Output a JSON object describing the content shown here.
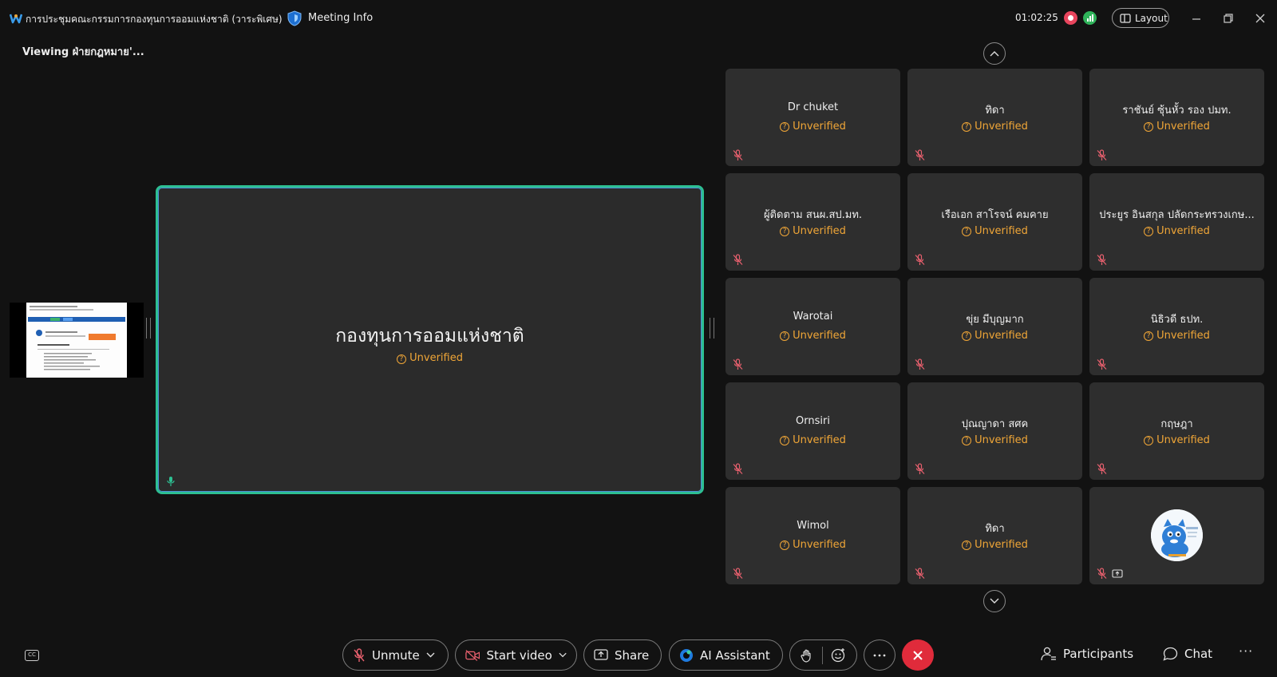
{
  "titlebar": {
    "meeting_title": "การประชุมคณะกรรมการกองทุนการออมแห่งชาติ (วาระพิเศษ)",
    "meeting_info_label": "Meeting Info",
    "timer": "01:02:25",
    "layout_label": "Layout"
  },
  "viewing_text": "Viewing ฝ่ายกฎหมาย'...",
  "main_stage": {
    "name": "กองทุนการออมแห่งชาติ",
    "status": "Unverified"
  },
  "participants": [
    {
      "name": "Dr chuket",
      "status": "Unverified"
    },
    {
      "name": "ทิดา",
      "status": "Unverified"
    },
    {
      "name": "ราชันย์ ซุ้นหั้ว รอง ปมท.",
      "status": "Unverified"
    },
    {
      "name": "ผู้ติดตาม สนผ.สป.มท.",
      "status": "Unverified"
    },
    {
      "name": "เรือเอก สาโรจน์ คมคาย",
      "status": "Unverified"
    },
    {
      "name": "ประยูร อินสกุล ปลัดกระทรวงเกษ...",
      "status": "Unverified"
    },
    {
      "name": "Warotai",
      "status": "Unverified"
    },
    {
      "name": "ขุ่ย  มีบุญมาก",
      "status": "Unverified"
    },
    {
      "name": "นิธิวดี ธปท.",
      "status": "Unverified"
    },
    {
      "name": "Ornsiri",
      "status": "Unverified"
    },
    {
      "name": "ปุณญาดา สศค",
      "status": "Unverified"
    },
    {
      "name": "กฤษฎา",
      "status": "Unverified"
    },
    {
      "name": "Wimol",
      "status": "Unverified"
    },
    {
      "name": "ทิดา",
      "status": "Unverified"
    }
  ],
  "toolbar": {
    "cc_label": "CC",
    "unmute_label": "Unmute",
    "start_video_label": "Start video",
    "share_label": "Share",
    "ai_assistant_label": "AI Assistant",
    "participants_label": "Participants",
    "chat_label": "Chat"
  },
  "colors": {
    "unverified": "#f0a637",
    "active_speaker_border": "#2dbf92",
    "leave": "#e02b3b",
    "muted_mic": "#e8606e"
  }
}
